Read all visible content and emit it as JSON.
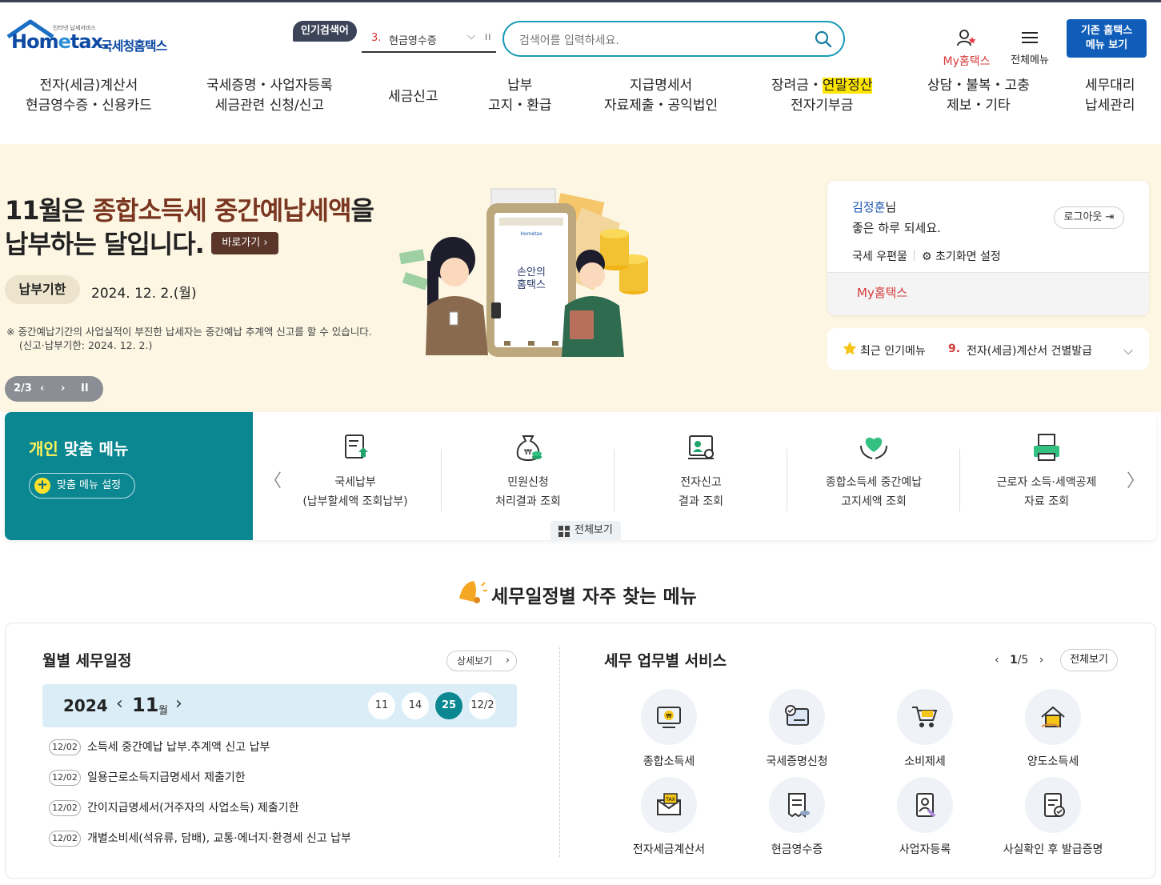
{
  "header": {
    "logo_small": "인터넷 납세서비스",
    "logo_brand_a": "Hom",
    "logo_brand_e": "e",
    "logo_brand_b": "tax.",
    "logo_kr": "국세청홈택스",
    "popular_label": "인기검색어",
    "popular_rank": "3.",
    "popular_text": "현금영수증",
    "search_placeholder": "검색어를 입력하세요.",
    "myhometax": "My홈택스",
    "all_menu": "전체메뉴",
    "old_home_1": "기존 홈택스",
    "old_home_2": "메뉴 보기"
  },
  "gnb": [
    {
      "l1": "전자(세금)계산서",
      "l2": "현금영수증・신용카드"
    },
    {
      "l1": "국세증명・사업자등록",
      "l2": "세금관련 신청/신고"
    },
    {
      "l1": "세금신고",
      "l2": ""
    },
    {
      "l1": "납부",
      "l2": "고지・환급"
    },
    {
      "l1": "지급명세서",
      "l2": "자료제출・공익법인"
    },
    {
      "l1a": "장려금・",
      "l1b": "연말정산",
      "l2": "전자기부금"
    },
    {
      "l1": "상담・불복・고충",
      "l2": "제보・기타"
    },
    {
      "l1": "세무대리",
      "l2": "납세관리"
    }
  ],
  "banner": {
    "line1_a": "11월은 ",
    "line1_b": "종합소득세 중간예납세액",
    "line1_c": "을",
    "line2": "납부하는 달입니다.",
    "go_button": "바로가기",
    "due_label": "납부기한",
    "due_date": "2024. 12. 2.(월)",
    "note1": "※ 중간예납기간의 사업실적이 부진한 납세자는 중간예납 추계액 신고를 할 수 있습니다.",
    "note2": "(신고·납부기한: 2024. 12. 2.)",
    "pager": "2/3",
    "phone_text_1": "손안의",
    "phone_text_2": "홈택스"
  },
  "login": {
    "user": "김정훈",
    "suffix": "님",
    "greeting": "좋은 하루 되세요.",
    "logout": "로그아웃",
    "mailbox": "국세 우편물",
    "settings": "초기화면 설정",
    "myhometax": "My홈택스"
  },
  "recent": {
    "label": "최근 인기메뉴",
    "rank": "9.",
    "text": "전자(세금)계산서 건별발급"
  },
  "personal": {
    "title_a": "개인",
    "title_b": " 맞춤 메뉴",
    "setting_button": "맞춤 메뉴 설정",
    "all_view": "전체보기",
    "cards": [
      {
        "l1": "국세납부",
        "l2": "(납부할세액 조회납부)",
        "icon": "tax-payment-icon"
      },
      {
        "l1": "민원신청",
        "l2": "처리결과 조회",
        "icon": "money-bag-icon"
      },
      {
        "l1": "전자신고",
        "l2": "결과 조회",
        "icon": "e-filing-result-icon"
      },
      {
        "l1": "종합소득세 중간예납",
        "l2": "고지세액 조회",
        "icon": "heart-hands-icon"
      },
      {
        "l1": "근로자 소득·세액공제",
        "l2": "자료 조회",
        "icon": "printer-icon"
      }
    ]
  },
  "section_title": "세무일정별 자주 찾는 메뉴",
  "calendar": {
    "title": "월별 세무일정",
    "detail": "상세보기",
    "year": "2024",
    "month": "11",
    "month_unit": "월",
    "days": [
      "11",
      "14",
      "25",
      "12/2"
    ],
    "selected_day": "25",
    "events": [
      {
        "date": "12/02",
        "text": "소득세 중간예납 납부.추계액 신고 납부"
      },
      {
        "date": "12/02",
        "text": "일용근로소득지급명세서 제출기한"
      },
      {
        "date": "12/02",
        "text": "간이지급명세서(거주자의 사업소득) 제출기한"
      },
      {
        "date": "12/02",
        "text": "개별소비세(석유류, 담배), 교통·에너지·환경세 신고 납부"
      }
    ]
  },
  "services": {
    "title": "세무 업무별 서비스",
    "page_current": "1",
    "page_total": "/5",
    "all_view": "전체보기",
    "items": [
      {
        "label": "종합소득세",
        "icon": "income-tax-icon"
      },
      {
        "label": "국세증명신청",
        "icon": "certificate-icon"
      },
      {
        "label": "소비제세",
        "icon": "shopping-cart-icon"
      },
      {
        "label": "양도소득세",
        "icon": "house-icon"
      },
      {
        "label": "전자세금계산서",
        "icon": "tax-envelope-icon"
      },
      {
        "label": "현금영수증",
        "icon": "receipt-icon"
      },
      {
        "label": "사업자등록",
        "icon": "business-registration-icon"
      },
      {
        "label": "사실확인 후 발급증명",
        "icon": "verified-document-icon"
      }
    ]
  },
  "colors": {
    "teal": "#0a8791",
    "navy_button": "#0f5db8",
    "search_border": "#1a9bb6",
    "accent_red": "#d63a3a",
    "banner_bg": "#fcf6e3",
    "highlight": "#ffe600"
  }
}
